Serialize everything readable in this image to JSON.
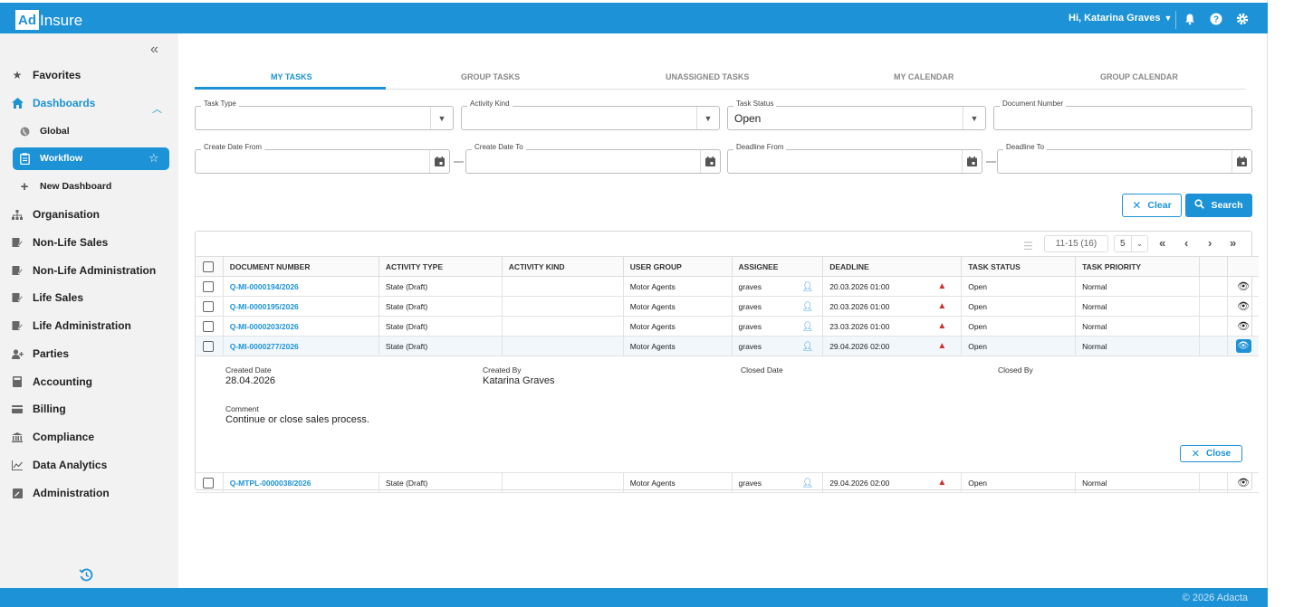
{
  "header": {
    "logo_ad": "Ad",
    "logo_insure": "Insure",
    "greeting": "Hi, Katarina Graves",
    "icons": [
      "bell-icon",
      "help-icon",
      "gear-icon"
    ]
  },
  "sidebar": {
    "items": [
      {
        "label": "Favorites",
        "icon": "star-icon"
      },
      {
        "label": "Dashboards",
        "icon": "home-icon"
      },
      {
        "label": "Global",
        "icon": "globe-icon"
      },
      {
        "label": "Workflow",
        "icon": "clipboard-icon"
      },
      {
        "label": "New Dashboard",
        "icon": "plus-icon"
      },
      {
        "label": "Organisation",
        "icon": "org-chart-icon"
      },
      {
        "label": "Non-Life Sales",
        "icon": "document-edit-icon"
      },
      {
        "label": "Non-Life Administration",
        "icon": "document-edit-icon"
      },
      {
        "label": "Life Sales",
        "icon": "document-edit-icon"
      },
      {
        "label": "Life Administration",
        "icon": "document-edit-icon"
      },
      {
        "label": "Parties",
        "icon": "person-add-icon"
      },
      {
        "label": "Accounting",
        "icon": "calculator-icon"
      },
      {
        "label": "Billing",
        "icon": "credit-card-icon"
      },
      {
        "label": "Compliance",
        "icon": "bank-icon"
      },
      {
        "label": "Data Analytics",
        "icon": "line-chart-icon"
      },
      {
        "label": "Administration",
        "icon": "admin-icon"
      }
    ]
  },
  "tabs": [
    "MY TASKS",
    "GROUP TASKS",
    "UNASSIGNED TASKS",
    "MY CALENDAR",
    "GROUP CALENDAR"
  ],
  "filters": {
    "task_type": {
      "label": "Task Type",
      "value": ""
    },
    "activity_kind": {
      "label": "Activity Kind",
      "value": ""
    },
    "task_status": {
      "label": "Task Status",
      "value": "Open"
    },
    "document_number": {
      "label": "Document Number",
      "value": ""
    },
    "create_date_from": {
      "label": "Create Date From",
      "value": ""
    },
    "create_date_to": {
      "label": "Create Date To",
      "value": ""
    },
    "deadline_from": {
      "label": "Deadline From",
      "value": ""
    },
    "deadline_to": {
      "label": "Deadline To",
      "value": ""
    }
  },
  "buttons": {
    "clear": "Clear",
    "search": "Search",
    "close": "Close"
  },
  "pager": {
    "range": "11-15 (16)",
    "page_size": "5"
  },
  "columns": [
    "DOCUMENT NUMBER",
    "ACTIVITY TYPE",
    "ACTIVITY KIND",
    "USER GROUP",
    "ASSIGNEE",
    "DEADLINE",
    "TASK STATUS",
    "TASK PRIORITY"
  ],
  "rows": [
    {
      "doc": "Q-MI-0000194/2026",
      "activity_type": "State (Draft)",
      "activity_kind": "",
      "user_group": "Motor Agents",
      "assignee": "graves",
      "deadline": "20.03.2026 01:00",
      "status": "Open",
      "priority": "Normal"
    },
    {
      "doc": "Q-MI-0000195/2026",
      "activity_type": "State (Draft)",
      "activity_kind": "",
      "user_group": "Motor Agents",
      "assignee": "graves",
      "deadline": "20.03.2026 01:00",
      "status": "Open",
      "priority": "Normal"
    },
    {
      "doc": "Q-MI-0000203/2026",
      "activity_type": "State (Draft)",
      "activity_kind": "",
      "user_group": "Motor Agents",
      "assignee": "graves",
      "deadline": "23.03.2026 01:00",
      "status": "Open",
      "priority": "Normal"
    },
    {
      "doc": "Q-MI-0000277/2026",
      "activity_type": "State (Draft)",
      "activity_kind": "",
      "user_group": "Motor Agents",
      "assignee": "graves",
      "deadline": "29.04.2026 02:00",
      "status": "Open",
      "priority": "Normal"
    },
    {
      "doc": "Q-MTPL-0000038/2026",
      "activity_type": "State (Draft)",
      "activity_kind": "",
      "user_group": "Motor Agents",
      "assignee": "graves",
      "deadline": "29.04.2026 02:00",
      "status": "Open",
      "priority": "Normal"
    }
  ],
  "detail": {
    "created_date_label": "Created Date",
    "created_date": "28.04.2026",
    "created_by_label": "Created By",
    "created_by": "Katarina Graves",
    "closed_date_label": "Closed Date",
    "closed_date": "",
    "closed_by_label": "Closed By",
    "closed_by": "",
    "comment_label": "Comment",
    "comment": "Continue or close sales process."
  },
  "footer": {
    "copyright": "© 2026 Adacta"
  },
  "colors": {
    "brand": "#1d92d6",
    "warning": "#d32f2f"
  }
}
